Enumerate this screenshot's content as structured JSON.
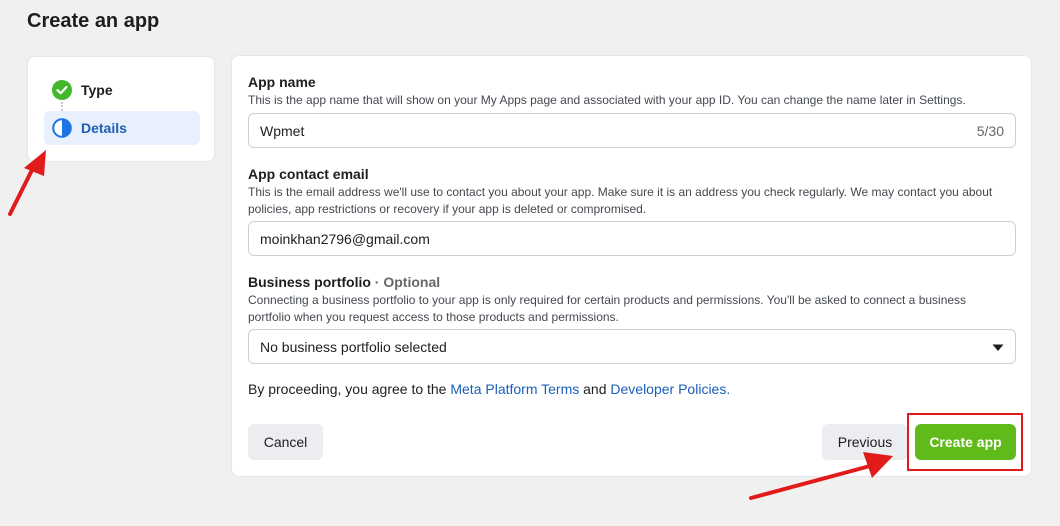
{
  "page": {
    "title": "Create an app"
  },
  "steps": [
    {
      "label": "Type",
      "state": "complete",
      "icon": "check-circle-icon"
    },
    {
      "label": "Details",
      "state": "active",
      "icon": "half-circle-icon"
    }
  ],
  "form": {
    "app_name": {
      "label": "App name",
      "help": "This is the app name that will show on your My Apps page and associated with your app ID. You can change the name later in Settings.",
      "value": "Wpmet",
      "counter": "5/30"
    },
    "contact_email": {
      "label": "App contact email",
      "help": "This is the email address we'll use to contact you about your app. Make sure it is an address you check regularly. We may contact you about policies, app restrictions or recovery if your app is deleted or compromised.",
      "value": "moinkhan2796@gmail.com"
    },
    "business_portfolio": {
      "label": "Business portfolio",
      "optional": " · Optional",
      "help": "Connecting a business portfolio to your app is only required for certain products and permissions. You'll be asked to connect a business portfolio when you request access to those products and permissions.",
      "selected": "No business portfolio selected"
    },
    "terms": {
      "prefix": "By proceeding, you agree to the ",
      "link1": "Meta Platform Terms",
      "middle": " and ",
      "link2": "Developer Policies."
    }
  },
  "buttons": {
    "cancel": "Cancel",
    "previous": "Previous",
    "create": "Create app"
  },
  "colors": {
    "accent_blue": "#1b5fb9",
    "create_green": "#5fba1a",
    "annotation_red": "#e11a1a"
  }
}
